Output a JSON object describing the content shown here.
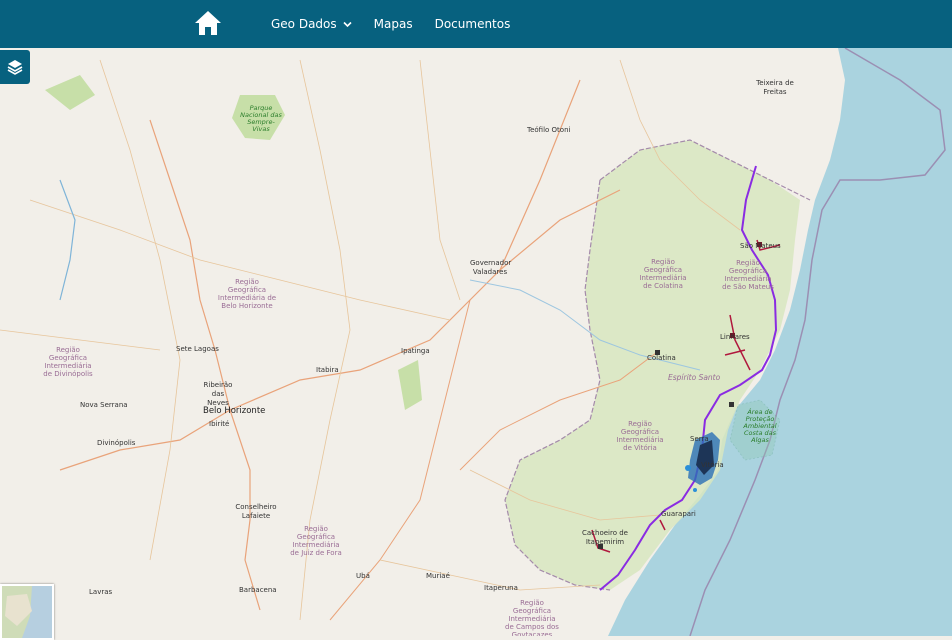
{
  "header": {
    "nav": [
      {
        "label": "Geo Dados",
        "has_dropdown": true
      },
      {
        "label": "Mapas"
      },
      {
        "label": "Documentos"
      }
    ],
    "home_icon": "home-icon",
    "bg_color": "#07617f"
  },
  "controls": {
    "layers_icon": "layers-icon"
  },
  "map": {
    "labels": {
      "teixeira": "Teixeira de Freitas",
      "teofilo": "Teófilo Otoni",
      "governador": "Governador Valadares",
      "sao_mateus": "São Mateus",
      "linhares": "Linhares",
      "colatina": "Colatina",
      "espirito_santo": "Espírito Santo",
      "ipatinga": "Ipatinga",
      "itabira": "Itabira",
      "sete_lagoas": "Sete Lagoas",
      "ribeirao": "Ribeirão das Neves",
      "nova_serrana": "Nova Serrana",
      "bh": "Belo Horizonte",
      "ibirite": "Ibirité",
      "divinopolis": "Divinópolis",
      "conselheiro": "Conselheiro Lafaiete",
      "barbacena": "Barbacena",
      "uba": "Ubá",
      "muriae": "Muriaé",
      "itaperuna": "Itaperuna",
      "lavras": "Lavras",
      "guarapari": "Guarapari",
      "cachoeiro": "Cachoeiro de Itapemirim",
      "serra": "Serra",
      "vitoria": "Vitória",
      "parque": "Parque Nacional das Sempre-Vivas",
      "apa": "Área de Proteção Ambiental Costa das Algas",
      "reg_colatina": "Região Geográfica Intermediária de Colatina",
      "reg_sao_mateus": "Região Geográfica Intermediária de São Mateus",
      "reg_bh": "Região Geográfica Intermediária de Belo Horizonte",
      "reg_divinopolis": "Região Geográfica Intermediária de Divinópolis",
      "reg_vitoria": "Região Geográfica Intermediária de Vitória",
      "reg_juiz": "Região Geográfica Intermediária de Juiz de Fora",
      "reg_campos": "Região Geográfica Intermediária de Campos dos Goytacazes"
    }
  }
}
